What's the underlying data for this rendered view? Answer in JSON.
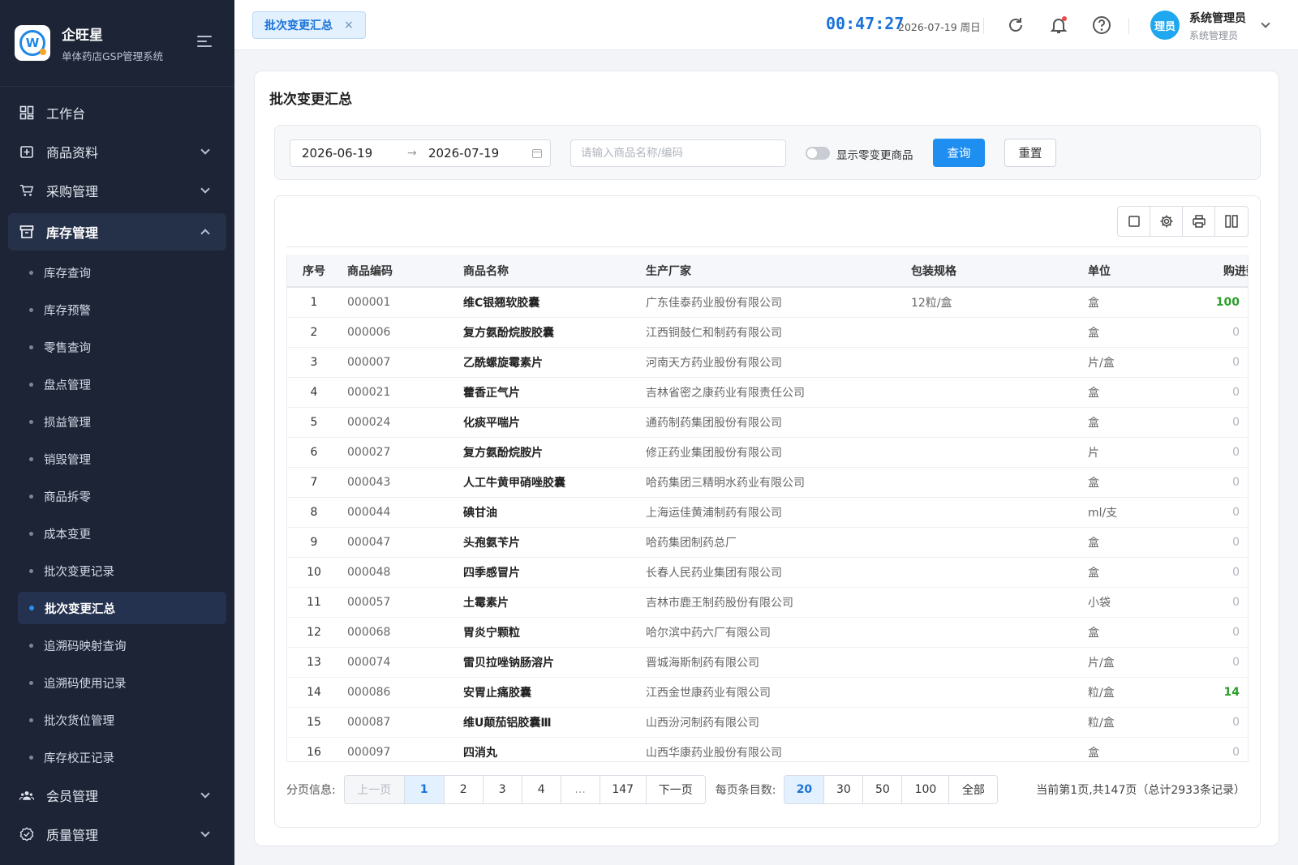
{
  "brand": {
    "name": "企旺星",
    "subtitle": "单体药店GSP管理系统"
  },
  "menu": [
    {
      "label": "工作台",
      "icon": "dashboard-icon"
    },
    {
      "label": "商品资料",
      "icon": "product-icon"
    },
    {
      "label": "采购管理",
      "icon": "cart-icon"
    },
    {
      "label": "库存管理",
      "icon": "inventory-icon"
    }
  ],
  "submenu": [
    "库存查询",
    "库存预警",
    "零售查询",
    "盘点管理",
    "损益管理",
    "销毁管理",
    "商品拆零",
    "成本变更",
    "批次变更记录",
    "批次变更汇总",
    "追溯码映射查询",
    "追溯码使用记录",
    "批次货位管理",
    "库存校正记录"
  ],
  "menu_bottom": [
    {
      "label": "会员管理",
      "icon": "members-icon"
    },
    {
      "label": "质量管理",
      "icon": "quality-icon"
    }
  ],
  "topbar": {
    "tab_label": "批次变更汇总",
    "tab_close": "×",
    "clock": "00:47:27",
    "date": "2026-07-19 周日",
    "avatar_text": "理员",
    "user_name": "系统管理员",
    "user_role": "系统管理员"
  },
  "page": {
    "title": "批次变更汇总",
    "date_start": "2026-06-19",
    "date_arrow": "→",
    "date_end": "2026-07-19",
    "search_placeholder": "请输入商品名称/编码",
    "switch_label": "显示零变更商品",
    "query_label": "查询",
    "reset_label": "重置"
  },
  "table": {
    "columns": [
      "序号",
      "商品编码",
      "商品名称",
      "生产厂家",
      "包装规格",
      "单位",
      "购进数量"
    ],
    "rows": [
      [
        "1",
        "000001",
        "维C银翘软胶囊",
        "广东佳泰药业股份有限公司",
        "12粒/盒",
        "盒",
        "100"
      ],
      [
        "2",
        "000006",
        "复方氨酚烷胺胶囊",
        "江西铜鼓仁和制药有限公司",
        "",
        "盒",
        "0"
      ],
      [
        "3",
        "000007",
        "乙酰螺旋霉素片",
        "河南天方药业股份有限公司",
        "",
        "片/盒",
        "0"
      ],
      [
        "4",
        "000021",
        "藿香正气片",
        "吉林省密之康药业有限责任公司",
        "",
        "盒",
        "0"
      ],
      [
        "5",
        "000024",
        "化痰平喘片",
        "通药制药集团股份有限公司",
        "",
        "盒",
        "0"
      ],
      [
        "6",
        "000027",
        "复方氨酚烷胺片",
        "修正药业集团股份有限公司",
        "",
        "片",
        "0"
      ],
      [
        "7",
        "000043",
        "人工牛黄甲硝唑胶囊",
        "哈药集团三精明水药业有限公司",
        "",
        "盒",
        "0"
      ],
      [
        "8",
        "000044",
        "碘甘油",
        "上海运佳黄浦制药有限公司",
        "",
        "ml/支",
        "0"
      ],
      [
        "9",
        "000047",
        "头孢氨苄片",
        "哈药集团制药总厂",
        "",
        "盒",
        "0"
      ],
      [
        "10",
        "000048",
        "四季感冒片",
        "长春人民药业集团有限公司",
        "",
        "盒",
        "0"
      ],
      [
        "11",
        "000057",
        "土霉素片",
        "吉林市鹿王制药股份有限公司",
        "",
        "小袋",
        "0"
      ],
      [
        "12",
        "000068",
        "胃炎宁颗粒",
        "哈尔滨中药六厂有限公司",
        "",
        "盒",
        "0"
      ],
      [
        "13",
        "000074",
        "雷贝拉唑钠肠溶片",
        "晋城海斯制药有限公司",
        "",
        "片/盒",
        "0"
      ],
      [
        "14",
        "000086",
        "安胃止痛胶囊",
        "江西金世康药业有限公司",
        "",
        "粒/盒",
        "14"
      ],
      [
        "15",
        "000087",
        "维U颠茄铝胶囊Ⅲ",
        "山西汾河制药有限公司",
        "",
        "粒/盒",
        "0"
      ],
      [
        "16",
        "000097",
        "四消丸",
        "山西华康药业股份有限公司",
        "",
        "盒",
        "0"
      ]
    ]
  },
  "pager": {
    "label": "分页信息:",
    "prev": "上一页",
    "pages": [
      "1",
      "2",
      "3",
      "4",
      "...",
      "147"
    ],
    "next": "下一页",
    "size_label": "每页条目数:",
    "sizes": [
      "20",
      "30",
      "50",
      "100",
      "全部"
    ],
    "summary": "当前第1页,共147页（总计2933条记录）"
  },
  "colors": {
    "accent": "#1e8ef0",
    "sidebar": "#1c2436",
    "positive": "#2aa02a"
  }
}
